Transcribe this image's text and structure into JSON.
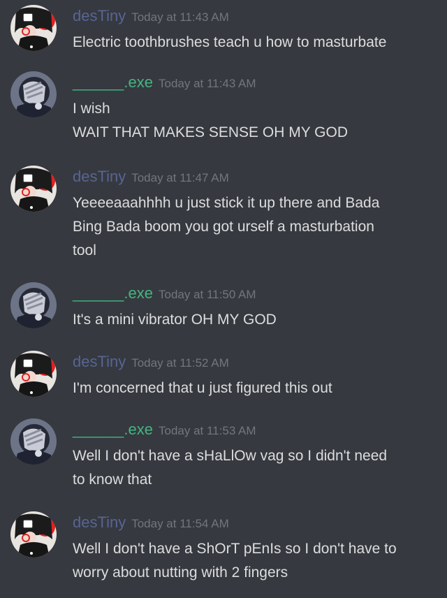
{
  "messages": [
    {
      "username": "desTiny",
      "timestamp": "Today at 11:43 AM",
      "lines": [
        "Electric toothbrushes teach u how to masturbate"
      ]
    },
    {
      "username": "______.exe",
      "timestamp": "Today at 11:43 AM",
      "lines": [
        "I wish",
        "WAIT THAT MAKES SENSE OH MY GOD"
      ]
    },
    {
      "username": "desTiny",
      "timestamp": "Today at 11:47 AM",
      "lines": [
        "Yeeeeaaahhhh u just stick it up there and Bada",
        "Bing Bada boom you got urself a masturbation",
        "tool"
      ]
    },
    {
      "username": "______.exe",
      "timestamp": "Today at 11:50 AM",
      "lines": [
        "It's a mini vibrator OH MY GOD"
      ]
    },
    {
      "username": "desTiny",
      "timestamp": "Today at 11:52 AM",
      "lines": [
        "I'm concerned that u just figured this out"
      ]
    },
    {
      "username": "______.exe",
      "timestamp": "Today at 11:53 AM",
      "lines": [
        "Well I don't have a sHaLlOw vag so I didn't need",
        "to know that"
      ]
    },
    {
      "username": "desTiny",
      "timestamp": "Today at 11:54 AM",
      "lines": [
        "Well I don't have a ShOrT pEnIs so I don't have to",
        "worry about nutting with 2 fingers"
      ]
    }
  ],
  "colors": {
    "background": "#36393f",
    "message_text": "#dcddde",
    "timestamp": "#72767d",
    "destiny_name": "#7289da",
    "exe_name": "#43b581"
  },
  "icons": {
    "destiny_avatar": "anime-girl-avatar-icon",
    "exe_avatar": "face-palm-avatar-icon"
  }
}
